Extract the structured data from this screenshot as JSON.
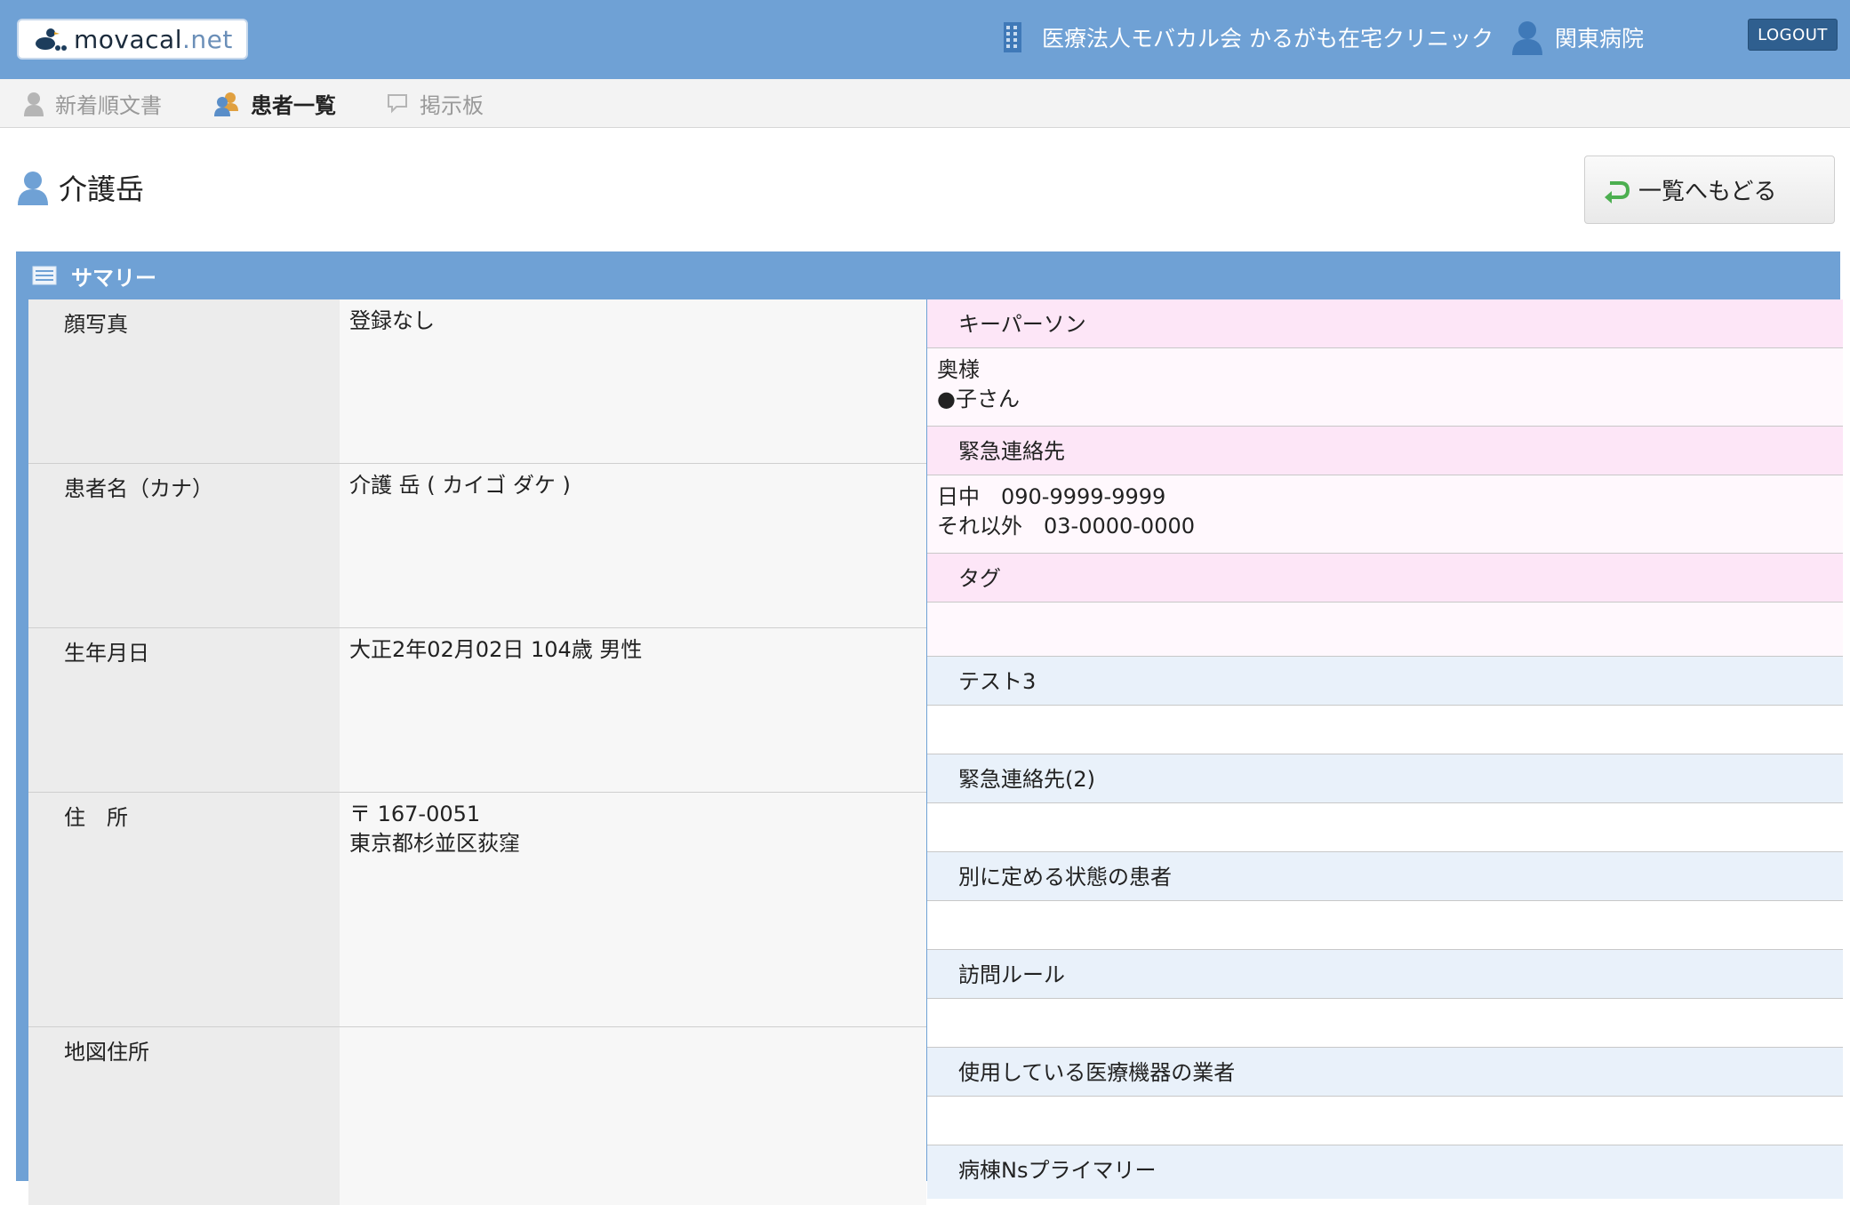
{
  "header": {
    "logo_main": "movacal",
    "logo_dot": ".net",
    "clinic_name": "医療法人モバカル会 かるがも在宅クリニック",
    "hospital_name": "関東病院",
    "logout_label": "LOGOUT"
  },
  "nav": {
    "items": [
      {
        "label": "新着順文書",
        "icon": "person-icon"
      },
      {
        "label": "患者一覧",
        "icon": "patients-icon"
      },
      {
        "label": "掲示板",
        "icon": "speech-bubble-icon"
      }
    ]
  },
  "patient": {
    "name": "介護岳",
    "back_label": "一覧へもどる"
  },
  "summary": {
    "title": "サマリー",
    "left_rows": [
      {
        "label": "顔写真",
        "value_lines": [
          "登録なし"
        ]
      },
      {
        "label": "患者名（カナ）",
        "value_lines": [
          "介護 岳 ( カイゴ ダケ )"
        ]
      },
      {
        "label": "生年月日",
        "value_lines": [
          "大正2年02月02日 104歳 男性"
        ]
      },
      {
        "label": "住　所",
        "value_lines": [
          "〒 167-0051",
          "東京都杉並区荻窪"
        ]
      },
      {
        "label": "地図住所",
        "value_lines": [
          ""
        ]
      }
    ],
    "right_rows": [
      {
        "type": "hpink",
        "text": "キーパーソン"
      },
      {
        "type": "vpink",
        "lines": [
          "奥様",
          "●子さん"
        ]
      },
      {
        "type": "hpink",
        "text": "緊急連絡先"
      },
      {
        "type": "vpink",
        "lines": [
          "日中　090-9999-9999",
          "それ以外　03-0000-0000"
        ]
      },
      {
        "type": "hpink",
        "text": "タグ"
      },
      {
        "type": "vpink",
        "lines": []
      },
      {
        "type": "hblue",
        "text": "テスト3"
      },
      {
        "type": "vwhite",
        "lines": []
      },
      {
        "type": "hblue",
        "text": "緊急連絡先(2)"
      },
      {
        "type": "vwhite",
        "lines": []
      },
      {
        "type": "hblue",
        "text": "別に定める状態の患者"
      },
      {
        "type": "vwhite",
        "lines": []
      },
      {
        "type": "hblue",
        "text": "訪問ルール"
      },
      {
        "type": "vwhite",
        "lines": []
      },
      {
        "type": "hblue",
        "text": "使用している医療機器の業者"
      },
      {
        "type": "vwhite",
        "lines": []
      },
      {
        "type": "hblue",
        "text": "病棟Nsプライマリー"
      }
    ]
  },
  "colors": {
    "header_bg": "#6fa1d5",
    "logout_bg": "#2f5f8f",
    "pink_header": "#fde6f7",
    "pink_value": "#fff8fd",
    "blue_header": "#e9f1fa"
  }
}
